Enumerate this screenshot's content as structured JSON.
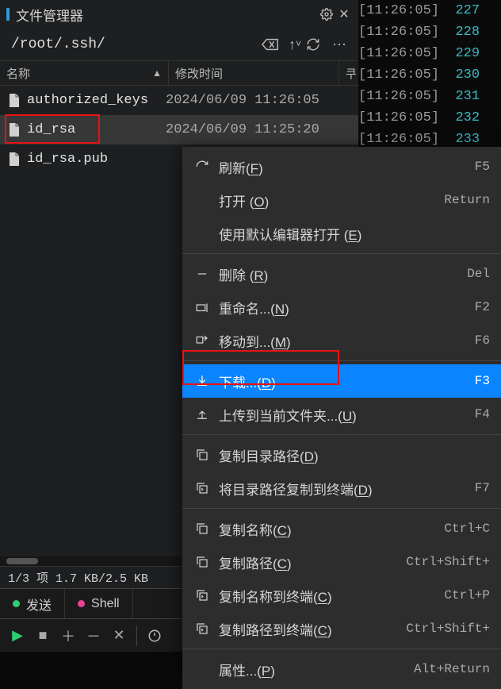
{
  "terminal": {
    "lines": [
      {
        "ts": "[11:26:05]",
        "n": "227"
      },
      {
        "ts": "[11:26:05]",
        "n": "228"
      },
      {
        "ts": "[11:26:05]",
        "n": "229"
      },
      {
        "ts": "[11:26:05]",
        "n": "230"
      },
      {
        "ts": "[11:26:05]",
        "n": "231"
      },
      {
        "ts": "[11:26:05]",
        "n": "232"
      },
      {
        "ts": "[11:26:05]",
        "n": "233"
      }
    ]
  },
  "panel": {
    "title": "文件管理器",
    "path": "/root/.ssh/",
    "columns": {
      "name": "名称",
      "mtime": "修改时间"
    },
    "files": [
      {
        "name": "authorized_keys",
        "mtime": "2024/06/09 11:26:05"
      },
      {
        "name": "id_rsa",
        "mtime": "2024/06/09 11:25:20"
      },
      {
        "name": "id_rsa.pub",
        "mtime": ""
      }
    ],
    "status": "1/3 项 1.7 KB/2.5 KB"
  },
  "tabs": {
    "a": "发送",
    "b": "Shell"
  },
  "menu": [
    {
      "icon": "refresh",
      "label": "刷新(",
      "u": "F",
      "tail": ")",
      "sc": "F5"
    },
    {
      "icon": "",
      "label": "打开 (",
      "u": "O",
      "tail": ")",
      "sc": "Return"
    },
    {
      "icon": "",
      "label": "使用默认编辑器打开 (",
      "u": "E",
      "tail": ")",
      "sc": ""
    },
    {
      "sep": true
    },
    {
      "icon": "minus",
      "label": "删除 (",
      "u": "R",
      "tail": ")",
      "sc": "Del"
    },
    {
      "icon": "rename",
      "label": "重命名...(",
      "u": "N",
      "tail": ")",
      "sc": "F2"
    },
    {
      "icon": "move",
      "label": "移动到...(",
      "u": "M",
      "tail": ")",
      "sc": "F6"
    },
    {
      "sep": true
    },
    {
      "icon": "download",
      "label": "下载...(",
      "u": "D",
      "tail": ")",
      "sc": "F3",
      "hl": true
    },
    {
      "icon": "upload",
      "label": "上传到当前文件夹...(",
      "u": "U",
      "tail": ")",
      "sc": "F4"
    },
    {
      "sep": true
    },
    {
      "icon": "copy",
      "label": "复制目录路径(",
      "u": "D",
      "tail": ")",
      "sc": ""
    },
    {
      "icon": "copyterm",
      "label": "将目录路径复制到终端(",
      "u": "D",
      "tail": ")",
      "sc": "F7"
    },
    {
      "sep": true
    },
    {
      "icon": "copy",
      "label": "复制名称(",
      "u": "C",
      "tail": ")",
      "sc": "Ctrl+C"
    },
    {
      "icon": "copy",
      "label": "复制路径(",
      "u": "C",
      "tail": ")",
      "sc": "Ctrl+Shift+"
    },
    {
      "icon": "copyterm",
      "label": "复制名称到终端(",
      "u": "C",
      "tail": ")",
      "sc": "Ctrl+P"
    },
    {
      "icon": "copyterm",
      "label": "复制路径到终端(",
      "u": "C",
      "tail": ")",
      "sc": "Ctrl+Shift+"
    },
    {
      "sep": true
    },
    {
      "icon": "",
      "label": "属性...(",
      "u": "P",
      "tail": ")",
      "sc": "Alt+Return"
    }
  ]
}
